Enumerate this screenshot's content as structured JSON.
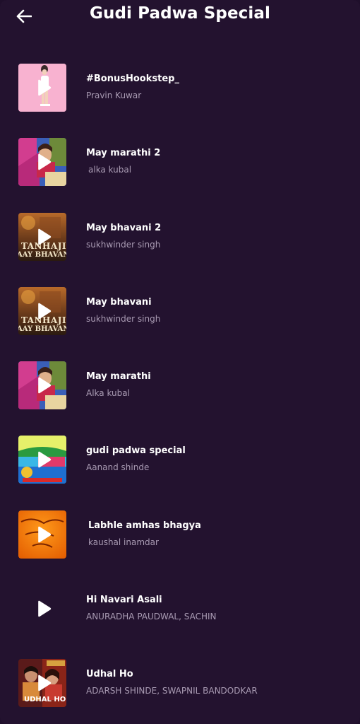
{
  "header": {
    "title": "Gudi Padwa Special",
    "back_icon": "arrow-left-icon"
  },
  "songs": [
    {
      "title": "#BonusHookstep_",
      "artist": "Pravin Kuwar",
      "thumb": "pink"
    },
    {
      "title": "May marathi 2",
      "artist": "alka kubal",
      "thumb": "marathi"
    },
    {
      "title": "May bhavani 2",
      "artist": "sukhwinder singh",
      "thumb": "tanhaji",
      "thumb_text_1": "TANHAJI",
      "thumb_text_2": "AAY BHAVAN"
    },
    {
      "title": "May bhavani",
      "artist": "sukhwinder singh",
      "thumb": "tanhaji",
      "thumb_text_1": "TANHAJI",
      "thumb_text_2": "AAY BHAVAN"
    },
    {
      "title": "May marathi",
      "artist": "Alka kubal",
      "thumb": "marathi"
    },
    {
      "title": "gudi padwa special",
      "artist": "Aanand shinde",
      "thumb": "gudi"
    },
    {
      "title": "Labhle amhas bhagya",
      "artist": "kaushal inamdar",
      "thumb": "orange"
    },
    {
      "title": "Hi Navari Asali",
      "artist": "ANURADHA PAUDWAL, SACHIN",
      "thumb": "none"
    },
    {
      "title": "Udhal Ho",
      "artist": "ADARSH SHINDE, SWAPNIL BANDODKAR",
      "thumb": "udhal",
      "thumb_text_1": "UDHAL HO"
    }
  ],
  "colors": {
    "background": "#23122f",
    "text_primary": "#ffffff",
    "text_secondary": "#a99bb3"
  },
  "icons": {
    "play": "play-icon"
  }
}
